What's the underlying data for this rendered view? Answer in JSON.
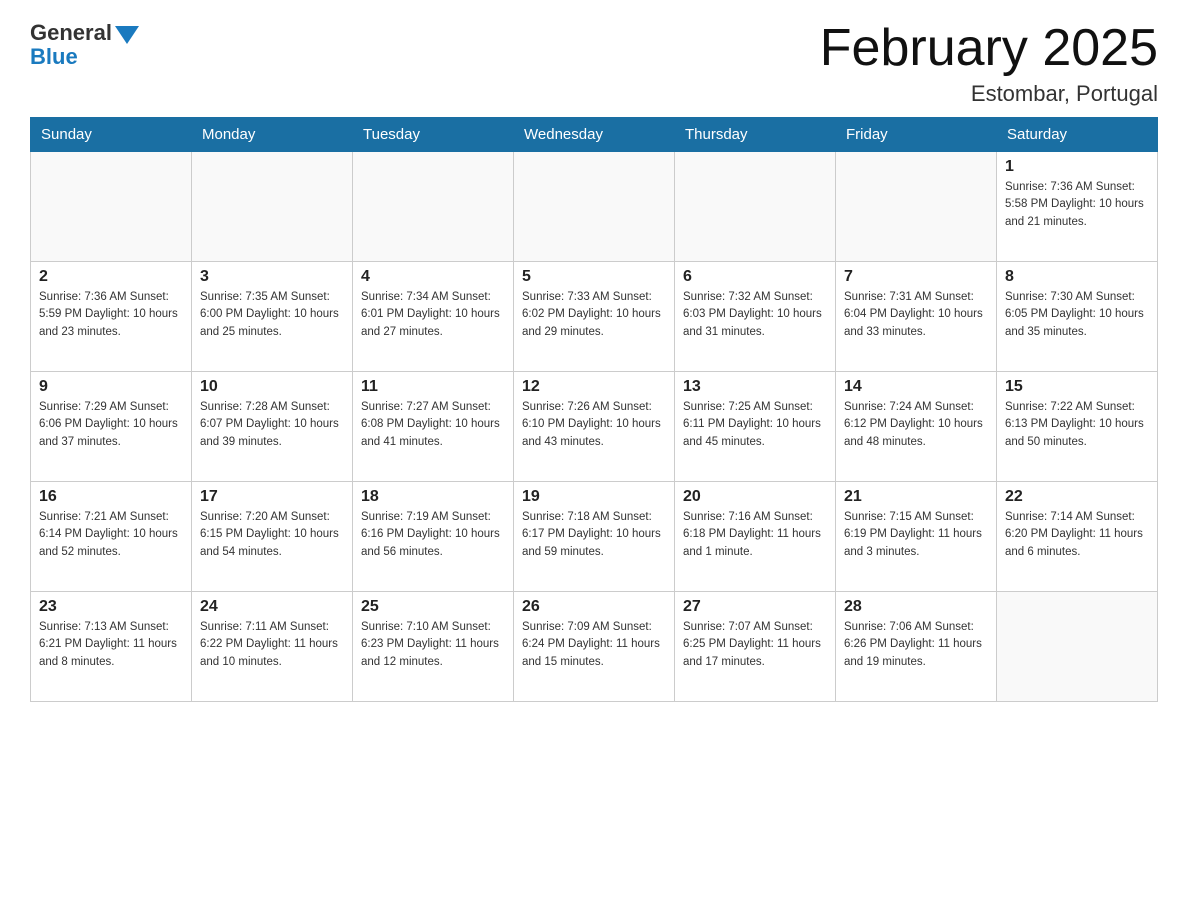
{
  "header": {
    "logo_general": "General",
    "logo_blue": "Blue",
    "title": "February 2025",
    "subtitle": "Estombar, Portugal"
  },
  "days_of_week": [
    "Sunday",
    "Monday",
    "Tuesday",
    "Wednesday",
    "Thursday",
    "Friday",
    "Saturday"
  ],
  "weeks": [
    [
      {
        "day": "",
        "info": ""
      },
      {
        "day": "",
        "info": ""
      },
      {
        "day": "",
        "info": ""
      },
      {
        "day": "",
        "info": ""
      },
      {
        "day": "",
        "info": ""
      },
      {
        "day": "",
        "info": ""
      },
      {
        "day": "1",
        "info": "Sunrise: 7:36 AM\nSunset: 5:58 PM\nDaylight: 10 hours\nand 21 minutes."
      }
    ],
    [
      {
        "day": "2",
        "info": "Sunrise: 7:36 AM\nSunset: 5:59 PM\nDaylight: 10 hours\nand 23 minutes."
      },
      {
        "day": "3",
        "info": "Sunrise: 7:35 AM\nSunset: 6:00 PM\nDaylight: 10 hours\nand 25 minutes."
      },
      {
        "day": "4",
        "info": "Sunrise: 7:34 AM\nSunset: 6:01 PM\nDaylight: 10 hours\nand 27 minutes."
      },
      {
        "day": "5",
        "info": "Sunrise: 7:33 AM\nSunset: 6:02 PM\nDaylight: 10 hours\nand 29 minutes."
      },
      {
        "day": "6",
        "info": "Sunrise: 7:32 AM\nSunset: 6:03 PM\nDaylight: 10 hours\nand 31 minutes."
      },
      {
        "day": "7",
        "info": "Sunrise: 7:31 AM\nSunset: 6:04 PM\nDaylight: 10 hours\nand 33 minutes."
      },
      {
        "day": "8",
        "info": "Sunrise: 7:30 AM\nSunset: 6:05 PM\nDaylight: 10 hours\nand 35 minutes."
      }
    ],
    [
      {
        "day": "9",
        "info": "Sunrise: 7:29 AM\nSunset: 6:06 PM\nDaylight: 10 hours\nand 37 minutes."
      },
      {
        "day": "10",
        "info": "Sunrise: 7:28 AM\nSunset: 6:07 PM\nDaylight: 10 hours\nand 39 minutes."
      },
      {
        "day": "11",
        "info": "Sunrise: 7:27 AM\nSunset: 6:08 PM\nDaylight: 10 hours\nand 41 minutes."
      },
      {
        "day": "12",
        "info": "Sunrise: 7:26 AM\nSunset: 6:10 PM\nDaylight: 10 hours\nand 43 minutes."
      },
      {
        "day": "13",
        "info": "Sunrise: 7:25 AM\nSunset: 6:11 PM\nDaylight: 10 hours\nand 45 minutes."
      },
      {
        "day": "14",
        "info": "Sunrise: 7:24 AM\nSunset: 6:12 PM\nDaylight: 10 hours\nand 48 minutes."
      },
      {
        "day": "15",
        "info": "Sunrise: 7:22 AM\nSunset: 6:13 PM\nDaylight: 10 hours\nand 50 minutes."
      }
    ],
    [
      {
        "day": "16",
        "info": "Sunrise: 7:21 AM\nSunset: 6:14 PM\nDaylight: 10 hours\nand 52 minutes."
      },
      {
        "day": "17",
        "info": "Sunrise: 7:20 AM\nSunset: 6:15 PM\nDaylight: 10 hours\nand 54 minutes."
      },
      {
        "day": "18",
        "info": "Sunrise: 7:19 AM\nSunset: 6:16 PM\nDaylight: 10 hours\nand 56 minutes."
      },
      {
        "day": "19",
        "info": "Sunrise: 7:18 AM\nSunset: 6:17 PM\nDaylight: 10 hours\nand 59 minutes."
      },
      {
        "day": "20",
        "info": "Sunrise: 7:16 AM\nSunset: 6:18 PM\nDaylight: 11 hours\nand 1 minute."
      },
      {
        "day": "21",
        "info": "Sunrise: 7:15 AM\nSunset: 6:19 PM\nDaylight: 11 hours\nand 3 minutes."
      },
      {
        "day": "22",
        "info": "Sunrise: 7:14 AM\nSunset: 6:20 PM\nDaylight: 11 hours\nand 6 minutes."
      }
    ],
    [
      {
        "day": "23",
        "info": "Sunrise: 7:13 AM\nSunset: 6:21 PM\nDaylight: 11 hours\nand 8 minutes."
      },
      {
        "day": "24",
        "info": "Sunrise: 7:11 AM\nSunset: 6:22 PM\nDaylight: 11 hours\nand 10 minutes."
      },
      {
        "day": "25",
        "info": "Sunrise: 7:10 AM\nSunset: 6:23 PM\nDaylight: 11 hours\nand 12 minutes."
      },
      {
        "day": "26",
        "info": "Sunrise: 7:09 AM\nSunset: 6:24 PM\nDaylight: 11 hours\nand 15 minutes."
      },
      {
        "day": "27",
        "info": "Sunrise: 7:07 AM\nSunset: 6:25 PM\nDaylight: 11 hours\nand 17 minutes."
      },
      {
        "day": "28",
        "info": "Sunrise: 7:06 AM\nSunset: 6:26 PM\nDaylight: 11 hours\nand 19 minutes."
      },
      {
        "day": "",
        "info": ""
      }
    ]
  ]
}
